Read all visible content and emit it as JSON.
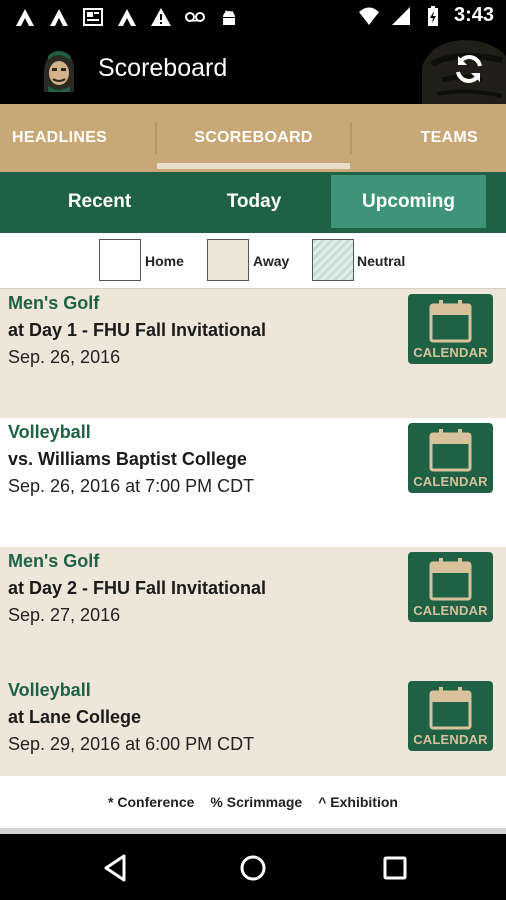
{
  "status_bar": {
    "time": "3:43"
  },
  "app_bar": {
    "title": "Scoreboard"
  },
  "tabs": [
    {
      "label": "HEADLINES"
    },
    {
      "label": "SCOREBOARD",
      "selected": true
    },
    {
      "label": "TEAMS"
    }
  ],
  "filters": [
    {
      "label": "Recent"
    },
    {
      "label": "Today"
    },
    {
      "label": "Upcoming",
      "selected": true
    }
  ],
  "legend": {
    "home": "Home",
    "away": "Away",
    "neutral": "Neutral"
  },
  "events": [
    {
      "sport": "Men's Golf",
      "opponent": "at Day 1 - FHU Fall Invitational",
      "date": "Sep. 26, 2016",
      "location": "away",
      "button": "CALENDAR"
    },
    {
      "sport": "Volleyball",
      "opponent": "vs. Williams Baptist College",
      "date": "Sep. 26, 2016 at 7:00 PM CDT",
      "location": "home",
      "button": "CALENDAR"
    },
    {
      "sport": "Men's Golf",
      "opponent": "at Day 2 - FHU Fall Invitational",
      "date": "Sep. 27, 2016",
      "location": "away",
      "button": "CALENDAR"
    },
    {
      "sport": "Volleyball",
      "opponent": "at Lane College",
      "date": "Sep. 29, 2016 at 6:00 PM CDT",
      "location": "away",
      "button": "CALENDAR"
    }
  ],
  "footer": {
    "conference": "* Conference",
    "scrimmage": "% Scrimmage",
    "exhibition": "^ Exhibition"
  },
  "colors": {
    "green": "#1f6144",
    "tan": "#c9a878",
    "away_bg": "#efe6da",
    "selected_filter": "#3e9479"
  }
}
